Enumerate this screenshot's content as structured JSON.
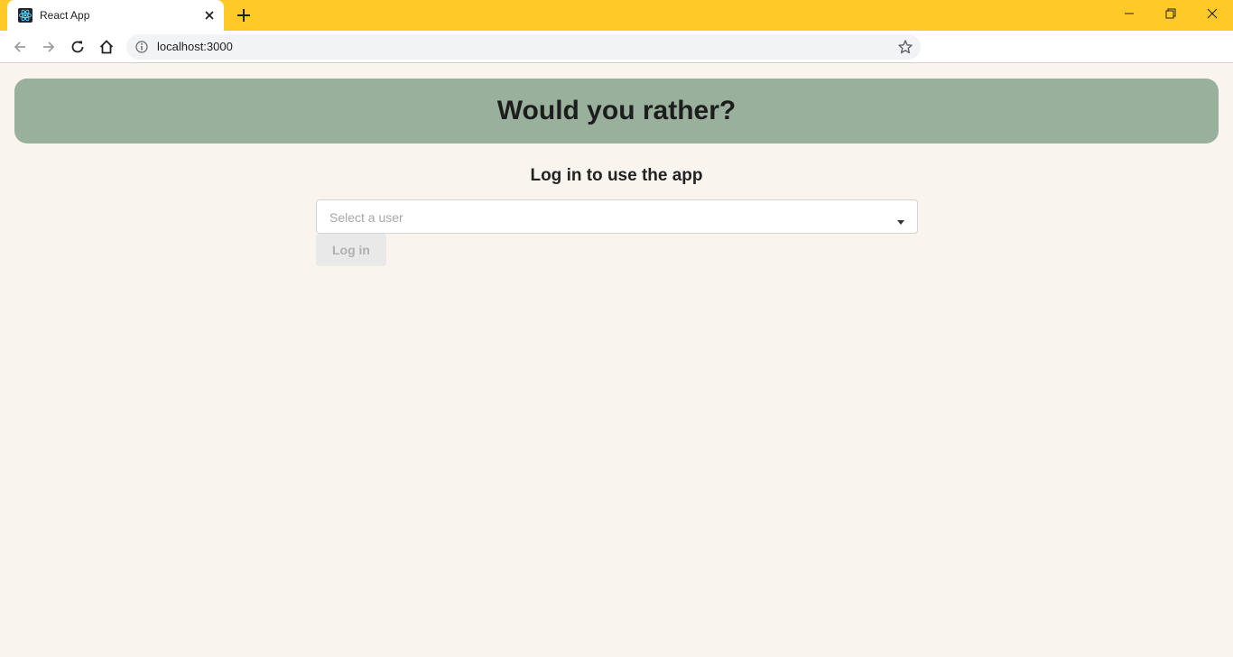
{
  "browser": {
    "tab_title": "React App",
    "url": "localhost:3000"
  },
  "app": {
    "title": "Would you rather?"
  },
  "login": {
    "heading": "Log in to use the app",
    "select_placeholder": "Select a user",
    "button_label": "Log in"
  },
  "colors": {
    "tabstrip": "#ffca28",
    "banner": "#99b09c",
    "page_bg": "#f9f4ee"
  }
}
